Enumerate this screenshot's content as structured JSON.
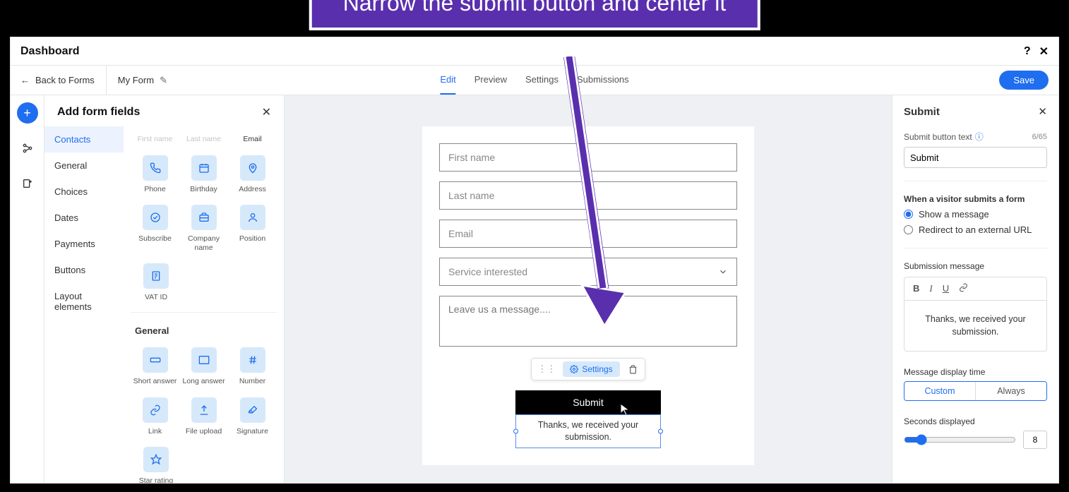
{
  "annotation": {
    "text": "Narrow the submit button and center it"
  },
  "topbar": {
    "title": "Dashboard"
  },
  "secondbar": {
    "back": "Back to Forms",
    "form_name": "My Form",
    "tabs": [
      "Edit",
      "Preview",
      "Settings",
      "Submissions"
    ],
    "save": "Save"
  },
  "left_panel": {
    "title": "Add form fields",
    "categories": [
      "Contacts",
      "General",
      "Choices",
      "Dates",
      "Payments",
      "Buttons",
      "Layout elements"
    ],
    "contacts_header_fields": [
      "First name",
      "Last name",
      "Email"
    ],
    "contacts_fields": [
      {
        "label": "Phone"
      },
      {
        "label": "Birthday"
      },
      {
        "label": "Address"
      },
      {
        "label": "Subscribe"
      },
      {
        "label": "Company name"
      },
      {
        "label": "Position"
      },
      {
        "label": "VAT ID"
      }
    ],
    "general_title": "General",
    "general_fields": [
      {
        "label": "Short answer"
      },
      {
        "label": "Long answer"
      },
      {
        "label": "Number"
      },
      {
        "label": "Link"
      },
      {
        "label": "File upload"
      },
      {
        "label": "Signature"
      },
      {
        "label": "Star rating"
      }
    ]
  },
  "form": {
    "fields": {
      "first_name": "First name",
      "last_name": "Last name",
      "email": "Email",
      "service": "Service interested",
      "message": "Leave us a message...."
    },
    "toolbar": {
      "settings": "Settings"
    },
    "submit_label": "Submit",
    "submit_msg": "Thanks, we received your submission."
  },
  "right_panel": {
    "title": "Submit",
    "button_text_label": "Submit button text",
    "button_text_count": "6/65",
    "button_text_value": "Submit",
    "action_title": "When a visitor submits a form",
    "action_show": "Show a message",
    "action_redirect": "Redirect to an external URL",
    "message_label": "Submission message",
    "message_body": "Thanks, we received your submission.",
    "display_time_label": "Message display time",
    "display_custom": "Custom",
    "display_always": "Always",
    "seconds_label": "Seconds displayed",
    "seconds_value": "8"
  }
}
